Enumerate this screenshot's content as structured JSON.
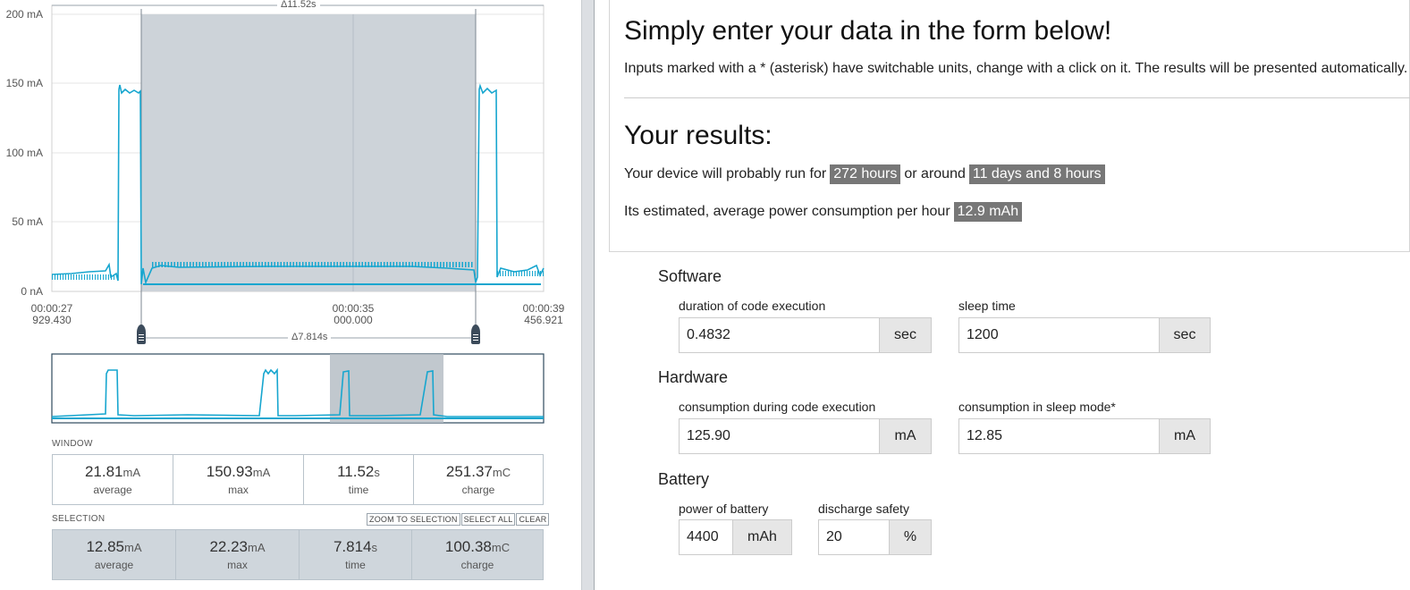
{
  "chart": {
    "y_ticks": [
      "200 mA",
      "150 mA",
      "100 mA",
      "50 mA",
      "0 nA"
    ],
    "x_ticks": [
      {
        "line1": "00:00:27",
        "line2": "929.430"
      },
      {
        "line1": "00:00:35",
        "line2": "000.000"
      },
      {
        "line1": "00:00:39",
        "line2": "456.921"
      }
    ],
    "window_delta": "Δ11.52s",
    "selection_delta": "Δ7.814s",
    "colors": {
      "trace": "#17a6cf",
      "selection": "#cdd3d9",
      "grid": "#e4e4e4"
    }
  },
  "window": {
    "label": "WINDOW",
    "stats": [
      {
        "value": "21.81",
        "unit": "mA",
        "label": "average"
      },
      {
        "value": "150.93",
        "unit": "mA",
        "label": "max"
      },
      {
        "value": "11.52",
        "unit": "s",
        "label": "time"
      },
      {
        "value": "251.37",
        "unit": "mC",
        "label": "charge"
      }
    ]
  },
  "selection": {
    "label": "SELECTION",
    "buttons": [
      "ZOOM TO SELECTION",
      "SELECT ALL",
      "CLEAR"
    ],
    "stats": [
      {
        "value": "12.85",
        "unit": "mA",
        "label": "average"
      },
      {
        "value": "22.23",
        "unit": "mA",
        "label": "max"
      },
      {
        "value": "7.814",
        "unit": "s",
        "label": "time"
      },
      {
        "value": "100.38",
        "unit": "mC",
        "label": "charge"
      }
    ]
  },
  "calculator": {
    "heading": "Simply enter your data in the form below!",
    "intro": "Inputs marked with a * (asterisk) have switchable units, change with a click on it. The results will be presented automatically.",
    "results_heading": "Your results:",
    "line1_prefix": "Your device will probably run for",
    "hours": "272 hours",
    "line1_mid": "or around",
    "days": "11 days and 8 hours",
    "line2_prefix": "Its estimated, average power consumption per hour",
    "avg": "12.9 mAh",
    "groups": {
      "software": "Software",
      "hardware": "Hardware",
      "battery": "Battery"
    },
    "fields": {
      "exec_duration": {
        "label": "duration of code execution",
        "value": "0.4832",
        "unit": "sec"
      },
      "sleep_time": {
        "label": "sleep time",
        "value": "1200",
        "unit": "sec"
      },
      "exec_consumption": {
        "label": "consumption during code execution",
        "value": "125.90",
        "unit": "mA"
      },
      "sleep_consumption": {
        "label": "consumption in sleep mode*",
        "value": "12.85",
        "unit": "mA"
      },
      "battery_power": {
        "label": "power of battery",
        "value": "4400",
        "unit": "mAh"
      },
      "discharge_safety": {
        "label": "discharge safety",
        "value": "20",
        "unit": "%"
      }
    }
  }
}
